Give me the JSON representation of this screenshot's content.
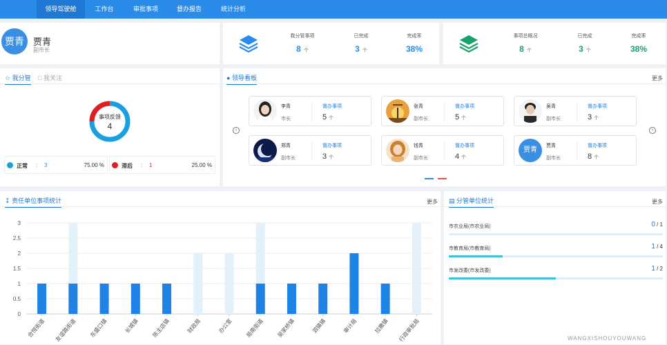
{
  "nav": {
    "tabs": [
      {
        "label": "领导驾驶舱",
        "active": true
      },
      {
        "label": "工作台",
        "active": false
      },
      {
        "label": "审批事项",
        "active": false
      },
      {
        "label": "督办报告",
        "active": false
      },
      {
        "label": "统计分析",
        "active": false
      }
    ]
  },
  "user": {
    "avatar_text": "贾青",
    "name": "贾青",
    "role": "副市长"
  },
  "stats_left": {
    "icon": "layers-icon",
    "color": "#2b8be8",
    "items": [
      {
        "label": "我分管事项",
        "value": "8",
        "unit": "个"
      },
      {
        "label": "已完成",
        "value": "3",
        "unit": "个"
      },
      {
        "label": "完成率",
        "value": "38%",
        "unit": ""
      }
    ]
  },
  "stats_right": {
    "icon": "layers-icon",
    "color": "#1aa06a",
    "items": [
      {
        "label": "事项总概况",
        "value": "8",
        "unit": "个"
      },
      {
        "label": "已完成",
        "value": "3",
        "unit": "个"
      },
      {
        "label": "完成率",
        "value": "38%",
        "unit": ""
      }
    ]
  },
  "my_panel": {
    "tabs": [
      {
        "label": "我分管",
        "active": true
      },
      {
        "label": "我关注",
        "active": false
      }
    ],
    "donut": {
      "label": "事项反馈",
      "total": "4",
      "segments": [
        {
          "name": "正常",
          "value": 3,
          "color": "#1a9fe0"
        },
        {
          "name": "滞后",
          "value": 1,
          "color": "#e02020"
        }
      ]
    },
    "legend": [
      {
        "name": "正常",
        "count": "3",
        "pct": "75.00 %",
        "color": "#1a9fe0"
      },
      {
        "name": "滞后",
        "count": "1",
        "pct": "25.00 %",
        "color": "#e02020"
      }
    ],
    "colon": ":"
  },
  "leader_board": {
    "title": "领导看板",
    "more": "更多",
    "leaders": [
      {
        "name": "李青",
        "role": "市长",
        "task_label": "督办事项",
        "count": "5",
        "unit": "个",
        "avatar": "portrait-woman-icon"
      },
      {
        "name": "张青",
        "role": "副市长",
        "task_label": "督办事项",
        "count": "5",
        "unit": "个",
        "avatar": "sunset-silhouette-icon"
      },
      {
        "name": "吴青",
        "role": "副市长",
        "task_label": "督办事项",
        "count": "3",
        "unit": "个",
        "avatar": "portrait-man-icon"
      },
      {
        "name": "郑青",
        "role": "副市长",
        "task_label": "督办事项",
        "count": "3",
        "unit": "个",
        "avatar": "moon-night-icon"
      },
      {
        "name": "钱青",
        "role": "副市长",
        "task_label": "督办事项",
        "count": "4",
        "unit": "个",
        "avatar": "portrait-woman-2-icon"
      },
      {
        "name": "贾青",
        "role": "副市长",
        "task_label": "督办事项",
        "count": "8",
        "unit": "个",
        "avatar": "text-avatar",
        "avatar_text": "贾青"
      }
    ]
  },
  "responsibility": {
    "title": "责任单位事项统计",
    "more": "更多"
  },
  "chart_data": {
    "type": "bar",
    "categories": [
      "合悦街道",
      "友谊路街道",
      "东盛口镇",
      "长城镇",
      "陈主店镇",
      "财政局",
      "办公室",
      "局南街道",
      "吴家桥镇",
      "泗镇镇",
      "审计局",
      "拉撒镇",
      "行政审批局"
    ],
    "series": [
      {
        "values": [
          1,
          1,
          1,
          1,
          1,
          0,
          0,
          1,
          1,
          1,
          2,
          1,
          0
        ],
        "color": "#1f83e6"
      },
      {
        "values": [
          0,
          3,
          0,
          0,
          0,
          2,
          2,
          3,
          0,
          0,
          0,
          0,
          3
        ],
        "color": "#e3f1fb"
      }
    ],
    "ylim": [
      0,
      3
    ],
    "yticks": [
      "0",
      "0.5",
      "1",
      "1.5",
      "2",
      "2.5",
      "3"
    ],
    "grid": true
  },
  "units": {
    "title": "分管单位统计",
    "more": "更多",
    "rows": [
      {
        "name": "市农业局(市农业局)",
        "done": "0",
        "total": "1",
        "ratio": 0.0
      },
      {
        "name": "市教育局(市教育局)",
        "done": "1",
        "total": "4",
        "ratio": 0.25
      },
      {
        "name": "市发改委(市发改委)",
        "done": "1",
        "total": "2",
        "ratio": 0.5
      }
    ],
    "slash": " / "
  },
  "watermark": {
    "text": "WANGXISHOUYOUWANG"
  }
}
